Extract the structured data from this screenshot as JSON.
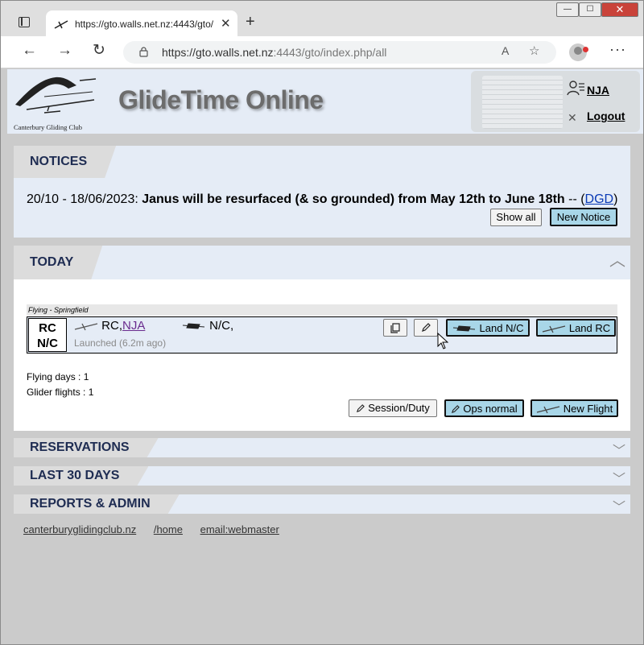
{
  "browser": {
    "tab_title": "https://gto.walls.net.nz:4443/gto/",
    "tab_close": "✕",
    "new_tab": "+",
    "url_main": "https://gto.walls.net.nz",
    "url_rest": ":4443/gto/index.php/all",
    "window_min": "—",
    "window_max": "☐",
    "window_close": "✕"
  },
  "header": {
    "club_name_line": "Canterbury  Gliding  Club",
    "app_title": "GlideTime Online",
    "user": "NJA",
    "logout": "Logout"
  },
  "notices": {
    "heading": "NOTICES",
    "date_range": "20/10 - 18/06/2023:",
    "message": "Janus will be resurfaced (& so grounded) from May 12th to June 18th",
    "sep": " -- (",
    "author": "DGD",
    "close_paren": ")",
    "show_all": "Show all",
    "new_notice": "New Notice"
  },
  "today": {
    "heading": "TODAY",
    "flying_label": "Flying - Springfield",
    "glider_line1": "RC",
    "glider_line2": "N/C",
    "crew1_prefix": "RC,",
    "crew1_link": "NJA",
    "crew2": "N/C,",
    "launched": "Launched (6.2m ago)",
    "land_nc": "Land N/C",
    "land_rc": "Land RC",
    "flying_days": "Flying days : 1",
    "glider_flights": "Glider flights : 1",
    "session_duty": "Session/Duty",
    "ops_normal": "Ops normal",
    "new_flight": "New Flight"
  },
  "sections": {
    "reservations": "RESERVATIONS",
    "last30": "LAST 30 DAYS",
    "reports": "REPORTS & ADMIN"
  },
  "footer": {
    "link1": "canterburyglidingclub.nz",
    "link2": "/home",
    "link3": " email:webmaster"
  },
  "colors": {
    "page_bg": "#cbcbcb",
    "panel_bg": "#e5ecf6",
    "heading": "#1e2c52",
    "button_blue": "#a8d6e8"
  }
}
